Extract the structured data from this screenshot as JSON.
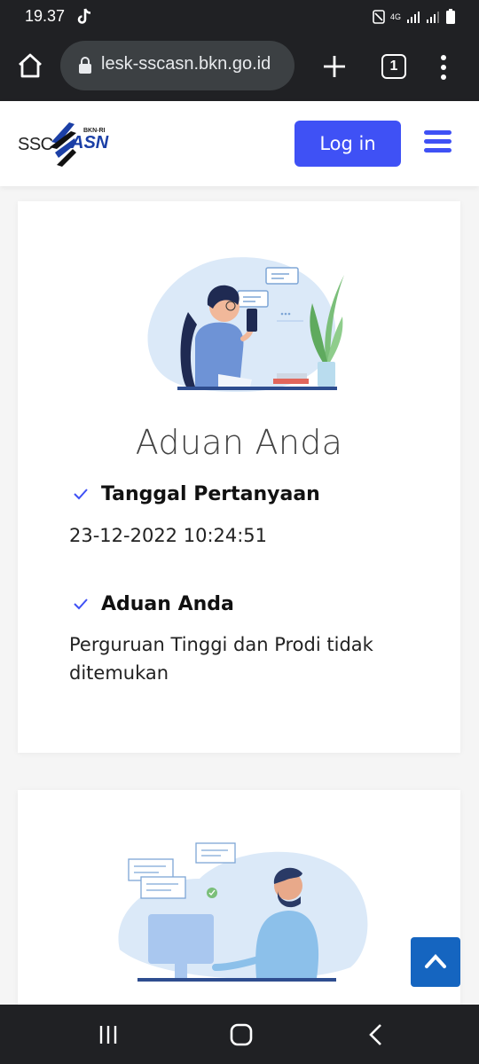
{
  "status_bar": {
    "time": "19.37",
    "network": "4G"
  },
  "browser": {
    "url": "lesk-sscasn.bkn.go.id",
    "tab_count": "1"
  },
  "header": {
    "logo_ssc": "SSC",
    "logo_asn": "ASN",
    "logo_bkn": "BKN-RI",
    "login_label": "Log in"
  },
  "complaint": {
    "title": "Aduan Anda",
    "date_label": "Tanggal Pertanyaan",
    "date_value": "23-12-2022 10:24:51",
    "complaint_label": "Aduan Anda",
    "complaint_value": "Perguruan Tinggi dan Prodi tidak ditemukan"
  },
  "colors": {
    "primary": "#3f51f5",
    "back_to_top": "#1565c0",
    "browser_chrome": "#202124",
    "url_box": "#3c4043"
  }
}
